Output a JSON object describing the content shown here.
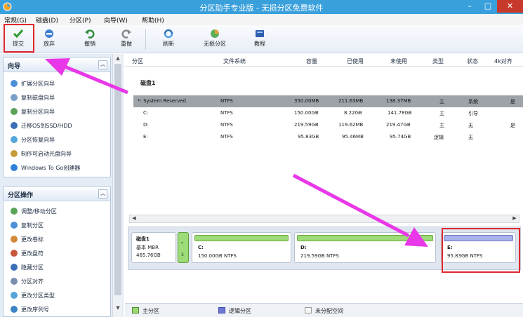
{
  "window": {
    "title": "分区助手专业版 - 无损分区免费软件",
    "minimize_glyph": "–",
    "maximize_glyph": "□",
    "close_glyph": "✕"
  },
  "menu": {
    "items": [
      "常规(G)",
      "磁盘(D)",
      "分区(P)",
      "向导(W)",
      "帮助(H)"
    ]
  },
  "toolbar": {
    "commit_label": "提交",
    "discard_label": "放弃",
    "undo_label": "撤销",
    "redo_label": "重做",
    "refresh_label": "刷新",
    "lossless_label": "无损分区",
    "tutorial_label": "教程"
  },
  "sidebar": {
    "wizard_title": "向导",
    "wizard_items": [
      "扩展分区向导",
      "复制磁盘向导",
      "复制分区向导",
      "迁移OS到SSD/HDD",
      "分区恢复向导",
      "制作可启动光盘向导",
      "Windows To Go创建器"
    ],
    "ops_title": "分区操作",
    "ops_items": [
      "调整/移动分区",
      "复制分区",
      "更改卷标",
      "更改盘符",
      "隐藏分区",
      "分区对齐",
      "更改分区类型",
      "更改序列号"
    ],
    "collapse_glyph": "︽"
  },
  "partition_table": {
    "columns": [
      "分区",
      "文件系统",
      "容量",
      "已使用",
      "未使用",
      "类型",
      "状态",
      "4k对齐"
    ],
    "disk_label": "磁盘1",
    "rows": [
      {
        "name": "*: System Reserved",
        "fs": "NTFS",
        "capacity": "350.00MB",
        "used": "211.63MB",
        "free": "138.37MB",
        "type": "主",
        "status": "系统",
        "align": "是"
      },
      {
        "name": "C:",
        "fs": "NTFS",
        "capacity": "150.00GB",
        "used": "8.22GB",
        "free": "141.78GB",
        "type": "主",
        "status": "引导",
        "align": ""
      },
      {
        "name": "D:",
        "fs": "NTFS",
        "capacity": "219.59GB",
        "used": "119.62MB",
        "free": "219.47GB",
        "type": "主",
        "status": "无",
        "align": "是"
      },
      {
        "name": "E:",
        "fs": "NTFS",
        "capacity": "95.83GB",
        "used": "95.46MB",
        "free": "95.74GB",
        "type": "逻辑",
        "status": "无",
        "align": ""
      }
    ]
  },
  "disk_map": {
    "disk_name": "磁盘1",
    "disk_type": "基本 MBR",
    "disk_size": "465.76GB",
    "sys_marker": "*",
    "sys_index": "3",
    "partitions": [
      {
        "name": "C:",
        "desc": "150.00GB NTFS",
        "used_fraction": 0.055
      },
      {
        "name": "D:",
        "desc": "219.59GB NTFS",
        "used_fraction": 0.01
      },
      {
        "name": "E:",
        "desc": "95.83GB NTFS",
        "used_fraction": 0.01
      }
    ]
  },
  "legend": {
    "primary": "主分区",
    "logical": "逻辑分区",
    "unallocated": "未分配空间"
  },
  "colors": {
    "title_bar": "#3aa0dc",
    "highlight_red": "#e0262e",
    "arrow_magenta": "#e838e8",
    "primary_green": "#9ddb78",
    "logical_blue": "#aab2ec"
  }
}
